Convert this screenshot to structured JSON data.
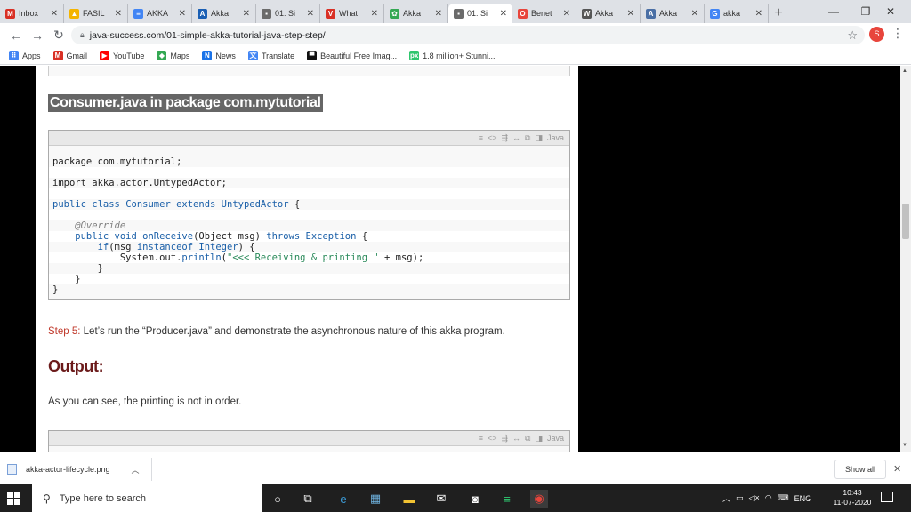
{
  "browser": {
    "tabs": [
      {
        "label": "Inbox",
        "icon": "gmail-icon",
        "color": "#d93025",
        "glyph": "M"
      },
      {
        "label": "FASIL",
        "icon": "drive-icon",
        "color": "#f4b400",
        "glyph": "▲"
      },
      {
        "label": "AKKA",
        "icon": "forms-icon",
        "color": "#4285f4",
        "glyph": "≡"
      },
      {
        "label": "Akka",
        "icon": "akka-icon",
        "color": "#1a5fb4",
        "glyph": "A"
      },
      {
        "label": "01: Si",
        "icon": "site-icon",
        "color": "#6b6b6b",
        "glyph": "▪"
      },
      {
        "label": "What",
        "icon": "v-icon",
        "color": "#d93025",
        "glyph": "V"
      },
      {
        "label": "Akka",
        "icon": "photos-icon",
        "color": "#34a853",
        "glyph": "✿"
      },
      {
        "label": "01: Si",
        "icon": "site-icon",
        "color": "#6b6b6b",
        "glyph": "▪"
      },
      {
        "label": "Benet",
        "icon": "opera-icon",
        "color": "#e8453c",
        "glyph": "O"
      },
      {
        "label": "Akka",
        "icon": "wikipedia-icon",
        "color": "#555555",
        "glyph": "W"
      },
      {
        "label": "Akka",
        "icon": "docs-icon",
        "color": "#4a6fa5",
        "glyph": "A"
      },
      {
        "label": "akka",
        "icon": "google-icon",
        "color": "#4285f4",
        "glyph": "G"
      }
    ],
    "active_tab_index": 7,
    "new_tab": "+",
    "url": "java-success.com/01-simple-akka-tutorial-java-step-step/",
    "profile_initial": "S"
  },
  "bookmarks": [
    {
      "label": "Apps",
      "icon": "apps-grid-icon",
      "color": "#4285f4",
      "glyph": "⠿"
    },
    {
      "label": "Gmail",
      "icon": "gmail-icon",
      "color": "#d93025",
      "glyph": "M"
    },
    {
      "label": "YouTube",
      "icon": "youtube-icon",
      "color": "#ff0000",
      "glyph": "▶"
    },
    {
      "label": "Maps",
      "icon": "maps-icon",
      "color": "#34a853",
      "glyph": "◆"
    },
    {
      "label": "News",
      "icon": "news-icon",
      "color": "#1a73e8",
      "glyph": "N"
    },
    {
      "label": "Translate",
      "icon": "translate-icon",
      "color": "#4285f4",
      "glyph": "文"
    },
    {
      "label": "Beautiful Free Imag...",
      "icon": "unsplash-icon",
      "color": "#111111",
      "glyph": "▀"
    },
    {
      "label": "1.8 million+ Stunni...",
      "icon": "pixabay-icon",
      "color": "#2ec66d",
      "glyph": "px"
    }
  ],
  "article": {
    "file_heading": "Consumer.java in package com.mytutorial",
    "code_lang": "Java",
    "code_lines": [
      [
        [
          "",
          "package com.mytutorial;"
        ]
      ],
      [
        [
          "",
          ""
        ]
      ],
      [
        [
          "",
          "import akka.actor.UntypedActor;"
        ]
      ],
      [
        [
          "",
          ""
        ]
      ],
      [
        [
          "kw",
          "public class "
        ],
        [
          "kw",
          "Consumer "
        ],
        [
          "kw",
          "extends "
        ],
        [
          "kw",
          "UntypedActor "
        ],
        [
          "",
          "{"
        ]
      ],
      [
        [
          "",
          ""
        ]
      ],
      [
        [
          "ann",
          "    @Override"
        ]
      ],
      [
        [
          "kw",
          "    public void "
        ],
        [
          "kw",
          "onReceive"
        ],
        [
          "",
          "(Object msg) "
        ],
        [
          "kw",
          "throws "
        ],
        [
          "kw",
          "Exception "
        ],
        [
          "",
          "{"
        ]
      ],
      [
        [
          "kw",
          "        if"
        ],
        [
          "",
          "(msg "
        ],
        [
          "kw",
          "instanceof "
        ],
        [
          "kw",
          "Integer"
        ],
        [
          "",
          ") {"
        ]
      ],
      [
        [
          "",
          "            System.out."
        ],
        [
          "kw",
          "println"
        ],
        [
          "",
          "("
        ],
        [
          "str",
          "\"<<< Receiving & printing \""
        ],
        [
          "",
          " + msg);"
        ]
      ],
      [
        [
          "",
          "        }"
        ]
      ],
      [
        [
          "",
          "    }"
        ]
      ],
      [
        [
          "",
          "}"
        ]
      ]
    ],
    "step5_prefix": "Step 5:",
    "step5_text": " Let’s run the “Producer.java” and demonstrate the asynchronous nature of this akka program.",
    "output_heading": "Output:",
    "output_text": "As you can see, the printing is not in order."
  },
  "download": {
    "filename": "akka-actor-lifecycle.png",
    "show_all": "Show all"
  },
  "taskbar": {
    "search_placeholder": "Type here to search",
    "lang": "ENG",
    "time": "10:43",
    "date": "11-07-2020"
  }
}
